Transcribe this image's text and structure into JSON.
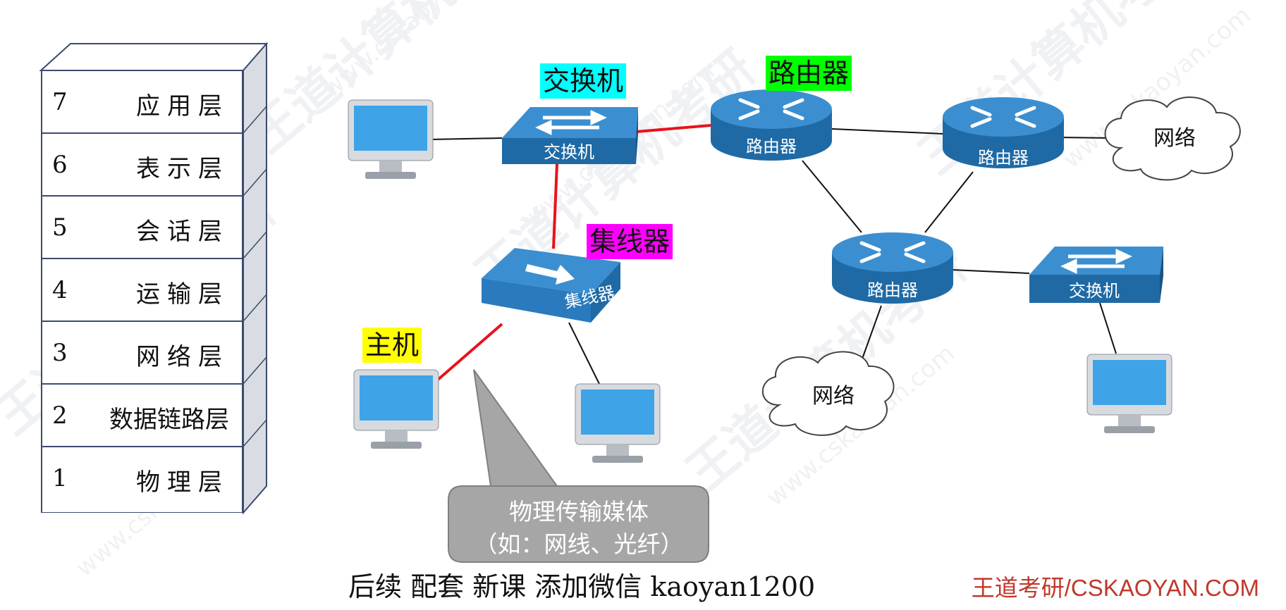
{
  "osi_layers": [
    {
      "number": "7",
      "name": "应用层"
    },
    {
      "number": "6",
      "name": "表示层"
    },
    {
      "number": "5",
      "name": "会话层"
    },
    {
      "number": "4",
      "name": "运输层"
    },
    {
      "number": "3",
      "name": "网络层"
    },
    {
      "number": "2",
      "name": "数据链路层"
    },
    {
      "number": "1",
      "name": "物理层"
    }
  ],
  "tags": {
    "switch": "交换机",
    "router": "路由器",
    "hub": "集线器",
    "host": "主机"
  },
  "device_labels": {
    "switch": "交换机",
    "router": "路由器",
    "hub": "集线器",
    "network": "网络"
  },
  "callout": {
    "line1": "物理传输媒体",
    "line2": "（如：网线、光纤）"
  },
  "footer": {
    "text": "后续 配套 新课 添加微信 kaoyan1200",
    "brand": "王道考研/CSKAOYAN.COM"
  },
  "watermark": {
    "brand": "王道计算机考研",
    "url": "www.cskaoyan.com"
  },
  "colors": {
    "switch_tag_bg": "#00ffff",
    "router_tag_bg": "#00ff00",
    "hub_tag_bg": "#ff00ff",
    "host_tag_bg": "#ffff00",
    "physical_link": "#e8131b",
    "device_blue": "#1f6aa5",
    "screen_blue": "#3fa3e8",
    "brand_red": "#c0392b"
  }
}
